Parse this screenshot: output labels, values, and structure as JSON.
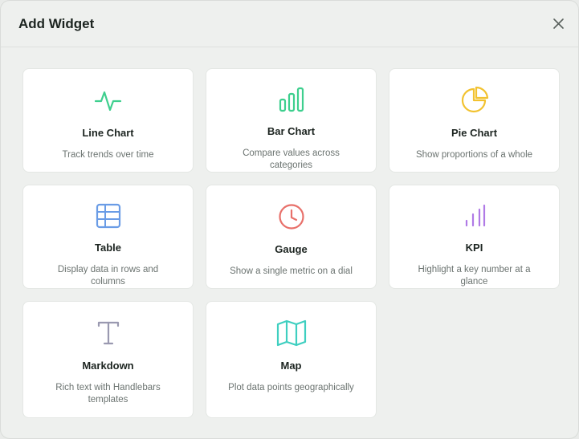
{
  "dialog": {
    "title": "Add Widget",
    "close_icon": "close-icon"
  },
  "widgets": [
    {
      "id": "line-chart",
      "label": "Line Chart",
      "description": "Track trends over time",
      "icon": "line-chart-icon",
      "color": "#3ecf8e"
    },
    {
      "id": "bar-chart",
      "label": "Bar Chart",
      "description": "Compare values across categories",
      "icon": "bar-chart-icon",
      "color": "#3ecf8e"
    },
    {
      "id": "pie-chart",
      "label": "Pie Chart",
      "description": "Show proportions of a whole",
      "icon": "pie-chart-icon",
      "color": "#f2c230"
    },
    {
      "id": "table",
      "label": "Table",
      "description": "Display data in rows and columns",
      "icon": "table-icon",
      "color": "#6a9ce6"
    },
    {
      "id": "gauge",
      "label": "Gauge",
      "description": "Show a single metric on a dial",
      "icon": "clock-icon",
      "color": "#e8706a"
    },
    {
      "id": "kpi",
      "label": "KPI",
      "description": "Highlight a key number at a glance",
      "icon": "signal-bars-icon",
      "color": "#b07ae6"
    },
    {
      "id": "markdown",
      "label": "Markdown",
      "description": "Rich text with Handlebars templates",
      "icon": "text-icon",
      "color": "#9a99b0"
    },
    {
      "id": "map",
      "label": "Map",
      "description": "Plot data points geographically",
      "icon": "map-icon",
      "color": "#3ecfc0"
    }
  ]
}
